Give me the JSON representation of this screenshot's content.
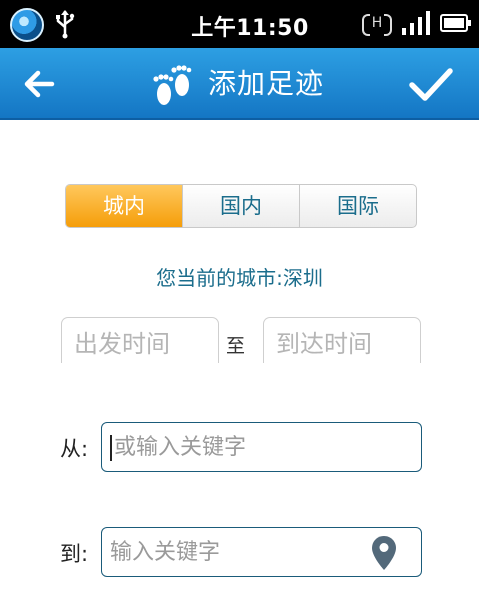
{
  "status_bar": {
    "time": "上午11:50",
    "network_badge": "H"
  },
  "header": {
    "title": "添加足迹",
    "back_icon": "arrow-left-icon",
    "confirm_icon": "checkmark-icon",
    "title_icon": "footprints-icon",
    "colors": {
      "bar": "#1f8ad4",
      "text": "#ffffff"
    }
  },
  "scope_tabs": [
    {
      "label": "城内",
      "selected": true
    },
    {
      "label": "国内",
      "selected": false
    },
    {
      "label": "国际",
      "selected": false
    }
  ],
  "current_city": "您当前的城市:深圳",
  "time_range": {
    "depart_placeholder": "出发时间",
    "separator": "至",
    "arrive_placeholder": "到达时间"
  },
  "from_field": {
    "label": "从:",
    "placeholder": "或输入关键字"
  },
  "to_field": {
    "label": "到:",
    "placeholder": "输入关键字",
    "icon": "location-pin-icon"
  },
  "colors": {
    "accent_orange": "#f59e0a",
    "link_teal": "#1b6d8c",
    "input_border": "#1a5b7a"
  }
}
